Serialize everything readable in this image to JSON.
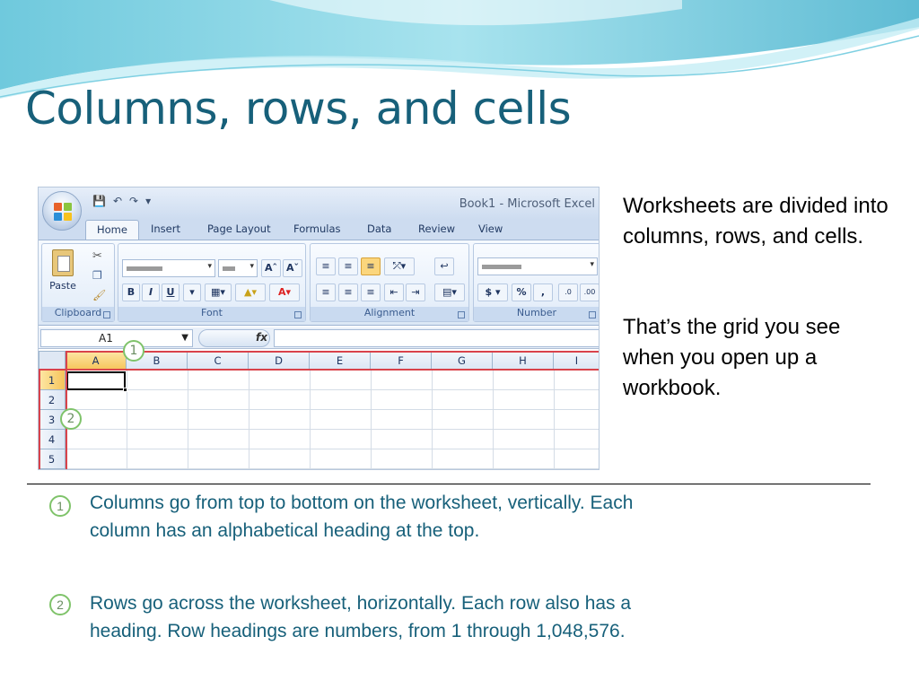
{
  "slide": {
    "title": "Columns, rows, and cells",
    "side_paragraphs": [
      "Worksheets are divided into columns, rows, and cells.",
      "That’s the grid you see when you open up a workbook."
    ],
    "notes": [
      {
        "number": "1",
        "text": "Columns go from top to bottom on the worksheet, vertically. Each column has an alphabetical heading at the top."
      },
      {
        "number": "2",
        "text": "Rows go across the worksheet, horizontally. Each row also has a heading. Row headings are numbers, from 1 through 1,048,576."
      }
    ]
  },
  "excel": {
    "window_title": "Book1 - Microsoft Excel",
    "tabs": [
      "Home",
      "Insert",
      "Page Layout",
      "Formulas",
      "Data",
      "Review",
      "View"
    ],
    "active_tab": "Home",
    "groups": [
      "Clipboard",
      "Font",
      "Alignment",
      "Number"
    ],
    "paste_label": "Paste",
    "font_buttons": {
      "bold": "B",
      "italic": "I",
      "underline": "U"
    },
    "number_buttons": {
      "currency": "$",
      "percent": "%",
      "comma": ","
    },
    "name_box": "A1",
    "fx": "fx",
    "columns": [
      "A",
      "B",
      "C",
      "D",
      "E",
      "F",
      "G",
      "H",
      "I"
    ],
    "rows": [
      "1",
      "2",
      "3",
      "4",
      "5"
    ],
    "callouts": [
      "1",
      "2"
    ]
  },
  "colors": {
    "title": "#17607a",
    "highlight_box": "#d9434b",
    "callout_ring": "#7fc36a",
    "selected_header": "#f6c45a"
  }
}
